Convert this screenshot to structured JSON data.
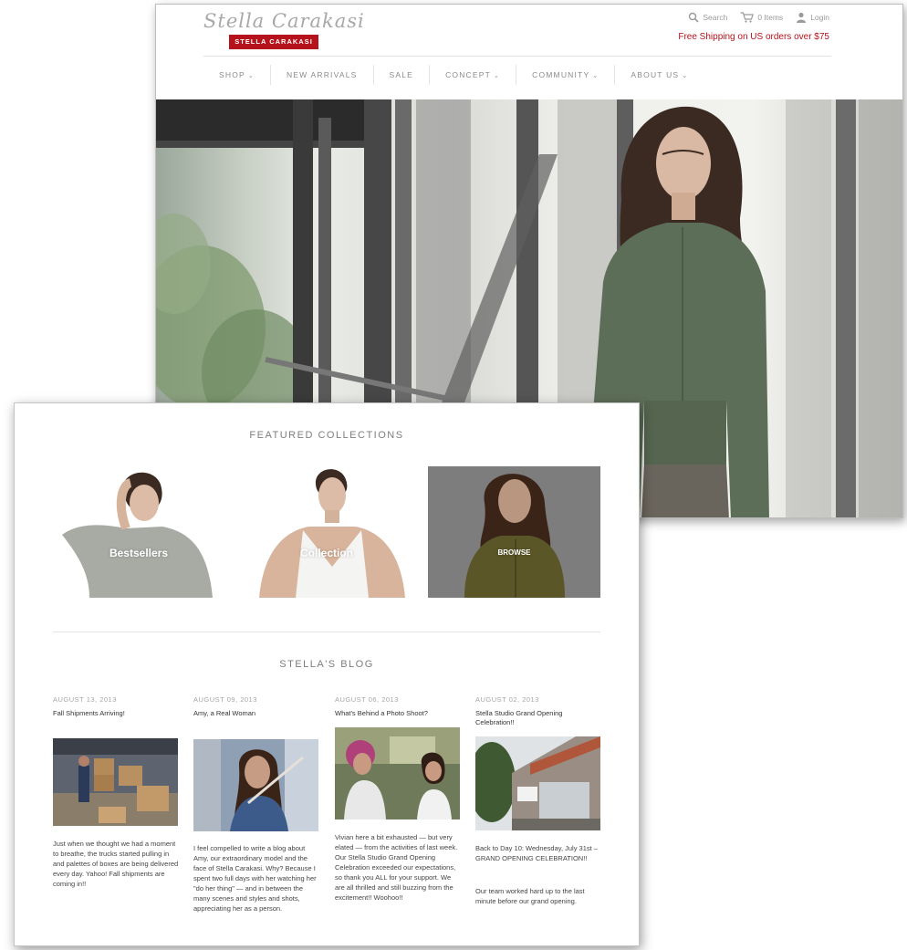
{
  "brand": {
    "script_logo": "Stella Carakasi",
    "logo_bar": "STELLA CARAKASI",
    "accent_color": "#b5121b"
  },
  "utility_bar": {
    "search_label": "Search",
    "cart_label": "0 Items",
    "login_label": "Login",
    "icons": [
      "search-icon",
      "cart-icon",
      "user-icon"
    ]
  },
  "promo": "Free Shipping on US orders over $75",
  "nav": {
    "items": [
      {
        "label": "SHOP",
        "has_dropdown": true
      },
      {
        "label": "NEW ARRIVALS",
        "has_dropdown": false
      },
      {
        "label": "SALE",
        "has_dropdown": false
      },
      {
        "label": "CONCEPT",
        "has_dropdown": true
      },
      {
        "label": "COMMUNITY",
        "has_dropdown": true
      },
      {
        "label": "ABOUT US",
        "has_dropdown": true
      }
    ],
    "dropdown_glyph": "⌄"
  },
  "featured": {
    "title": "FEATURED COLLECTIONS",
    "tiles": [
      {
        "label": "Bestsellers"
      },
      {
        "label": "Collection"
      },
      {
        "label": "BROWSE"
      }
    ]
  },
  "blog": {
    "title": "STELLA'S BLOG",
    "posts": [
      {
        "date": "AUGUST 13, 2013",
        "title": "Fall Shipments Arriving!",
        "body": "Just when we thought we had a moment to breathe, the trucks started pulling in and palettes of boxes are being delivered every day. Yahoo! Fall shipments are coming in!!"
      },
      {
        "date": "AUGUST 09, 2013",
        "title": "Amy, a Real Woman",
        "body": "I feel compelled to write a blog about Amy, our extraordinary model and the face of Stella Carakasi. Why? Because I spent two full days with her watching her \"do her thing\" — and in between the many scenes and styles and shots, appreciating her as a person."
      },
      {
        "date": "AUGUST 06, 2013",
        "title": "What's Behind a Photo Shoot?",
        "body": "Vivian here a bit exhausted — but very elated — from the activities of last week. Our Stella Studio Grand Opening Celebration exceeded our expectations, so thank you ALL for your support. We are all thrilled and still buzzing from the excitement!! Woohoo!!"
      },
      {
        "date": "AUGUST 02, 2013",
        "title": "Stella Studio Grand Opening Celebration!!",
        "body": "Back to Day 10: Wednesday, July 31st – GRAND OPENING CELEBRATION!!",
        "body2": "Our team worked hard up to the last minute before our grand opening."
      }
    ]
  }
}
